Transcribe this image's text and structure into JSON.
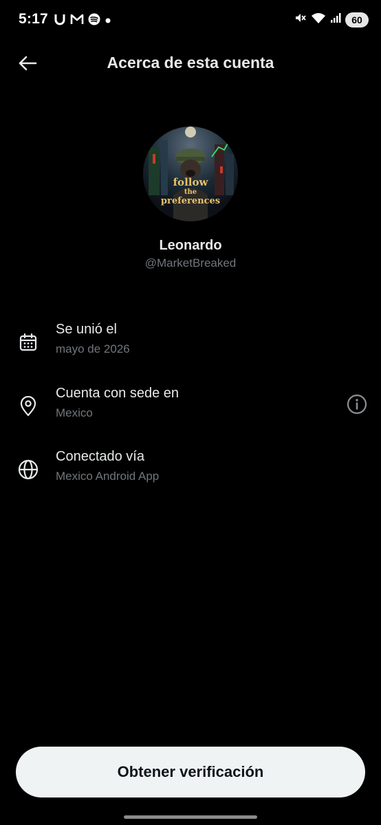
{
  "status_bar": {
    "time": "5:17",
    "battery": "60",
    "left_icons": [
      "notification-u-icon",
      "gmail-icon",
      "spotify-icon",
      "dot-icon"
    ],
    "right_icons": [
      "mute-vibrate-icon",
      "wifi-icon",
      "signal-icon",
      "battery-icon"
    ]
  },
  "header": {
    "title": "Acerca de esta cuenta",
    "back_icon": "arrow-left-icon"
  },
  "profile": {
    "display_name": "Leonardo",
    "handle": "@MarketBreaked",
    "avatar_text": [
      "follow",
      "the",
      "preferences"
    ]
  },
  "rows": [
    {
      "label": "Se unió el",
      "value": "mayo de 2026",
      "icon": "calendar-icon"
    },
    {
      "label": "Cuenta con sede en",
      "value": "Mexico",
      "icon": "location-pin-icon",
      "action_icon": "info-icon"
    },
    {
      "label": "Conectado vía",
      "value": "Mexico Android App",
      "icon": "globe-icon"
    }
  ],
  "footer": {
    "verify_label": "Obtener verificación"
  },
  "colors": {
    "background": "#000000",
    "primary_text": "#e7e9ea",
    "secondary_text": "#71767b",
    "button_bg": "#eff3f4",
    "button_text": "#0f1419"
  }
}
